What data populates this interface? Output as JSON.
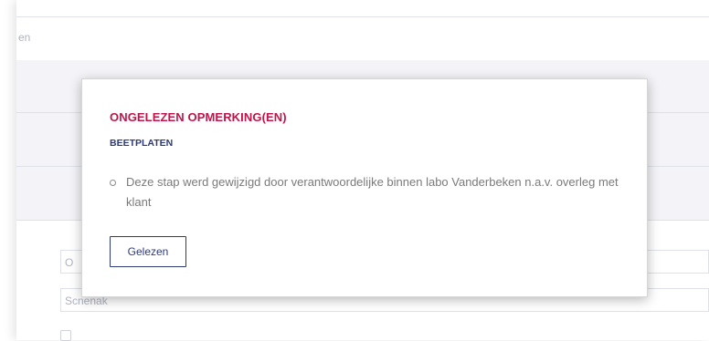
{
  "background": {
    "row1_label": "en",
    "input1_value": "O",
    "input2_value": "Scnenak"
  },
  "modal": {
    "title": "ONGELEZEN OPMERKING(EN)",
    "subtitle": "BEETPLATEN",
    "remarks": [
      "Deze stap werd gewijzigd door verantwoordelijke binnen labo Vanderbeken n.a.v. overleg met klant"
    ],
    "read_button_label": "Gelezen"
  },
  "colors": {
    "title": "#c0154a",
    "accent": "#2e3a78",
    "text": "#7a7a7a"
  }
}
